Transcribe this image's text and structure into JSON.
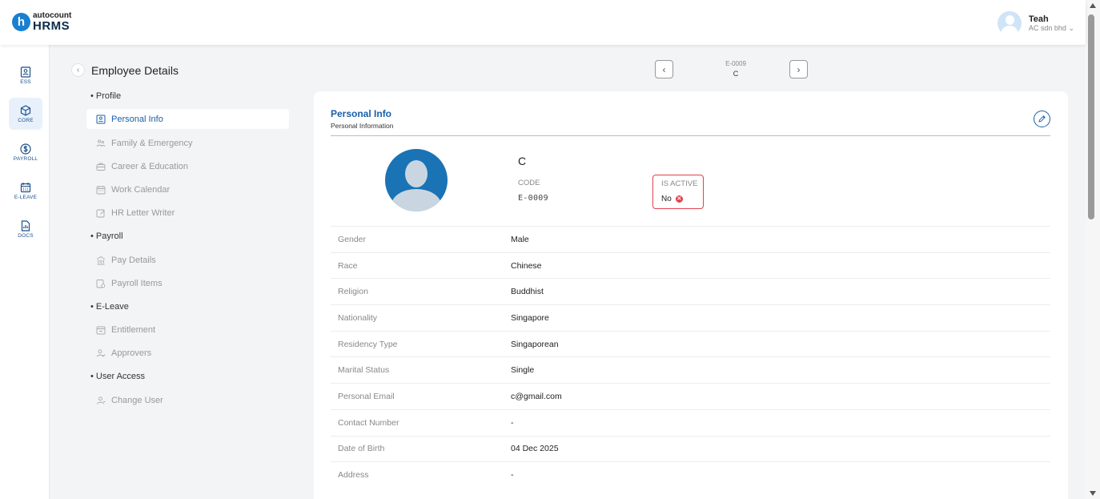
{
  "header": {
    "logo_top": "autocount",
    "logo_bottom": "HRMS",
    "logo_mark": "h",
    "user_name": "Teah",
    "user_company": "AC sdn bhd",
    "company_caret": "⌄"
  },
  "rail": {
    "items": [
      {
        "label": "ESS",
        "icon": "ess-icon",
        "active": false
      },
      {
        "label": "CORE",
        "icon": "cube-icon",
        "active": true
      },
      {
        "label": "PAYROLL",
        "icon": "dollar-icon",
        "active": false
      },
      {
        "label": "E-LEAVE",
        "icon": "calendar-icon",
        "active": false
      },
      {
        "label": "DOCS",
        "icon": "docs-icon",
        "active": false
      }
    ]
  },
  "page": {
    "title": "Employee Details",
    "back_icon": "‹"
  },
  "nav": {
    "sections": [
      {
        "label": "Profile"
      },
      {
        "label": "Payroll"
      },
      {
        "label": "E-Leave"
      },
      {
        "label": "User Access"
      }
    ],
    "items": [
      {
        "label": "Personal Info",
        "icon": "id-card-icon",
        "active": true
      },
      {
        "label": "Family & Emergency",
        "icon": "family-icon",
        "active": false
      },
      {
        "label": "Career & Education",
        "icon": "briefcase-icon",
        "active": false
      },
      {
        "label": "Work Calendar",
        "icon": "calendar-icon",
        "active": false
      },
      {
        "label": "HR Letter Writer",
        "icon": "letter-icon",
        "active": false
      },
      {
        "label": "Pay Details",
        "icon": "bank-icon",
        "active": false
      },
      {
        "label": "Payroll Items",
        "icon": "payroll-items-icon",
        "active": false
      },
      {
        "label": "Entitlement",
        "icon": "entitlement-icon",
        "active": false
      },
      {
        "label": "Approvers",
        "icon": "approvers-icon",
        "active": false
      },
      {
        "label": "Change User",
        "icon": "user-icon",
        "active": false
      }
    ]
  },
  "pager": {
    "code": "E-0009",
    "name": "C",
    "prev_icon": "‹",
    "next_icon": "›"
  },
  "card": {
    "title": "Personal Info",
    "subtitle": "Personal Information",
    "employee_name": "C",
    "code_label": "CODE",
    "code_value": "E-0009",
    "active_label": "IS ACTIVE",
    "active_value": "No",
    "active_status_icon": "✕",
    "rows": [
      {
        "label": "Gender",
        "value": "Male"
      },
      {
        "label": "Race",
        "value": "Chinese"
      },
      {
        "label": "Religion",
        "value": "Buddhist"
      },
      {
        "label": "Nationality",
        "value": "Singapore"
      },
      {
        "label": "Residency Type",
        "value": "Singaporean"
      },
      {
        "label": "Marital Status",
        "value": "Single"
      },
      {
        "label": "Personal Email",
        "value": "c@gmail.com"
      },
      {
        "label": "Contact Number",
        "value": "-"
      },
      {
        "label": "Date of Birth",
        "value": "04 Dec 2025"
      },
      {
        "label": "Address",
        "value": "-"
      }
    ]
  },
  "colors": {
    "brand": "#1a7fd0",
    "accent": "#1a5fa8",
    "danger": "#e0424a"
  }
}
